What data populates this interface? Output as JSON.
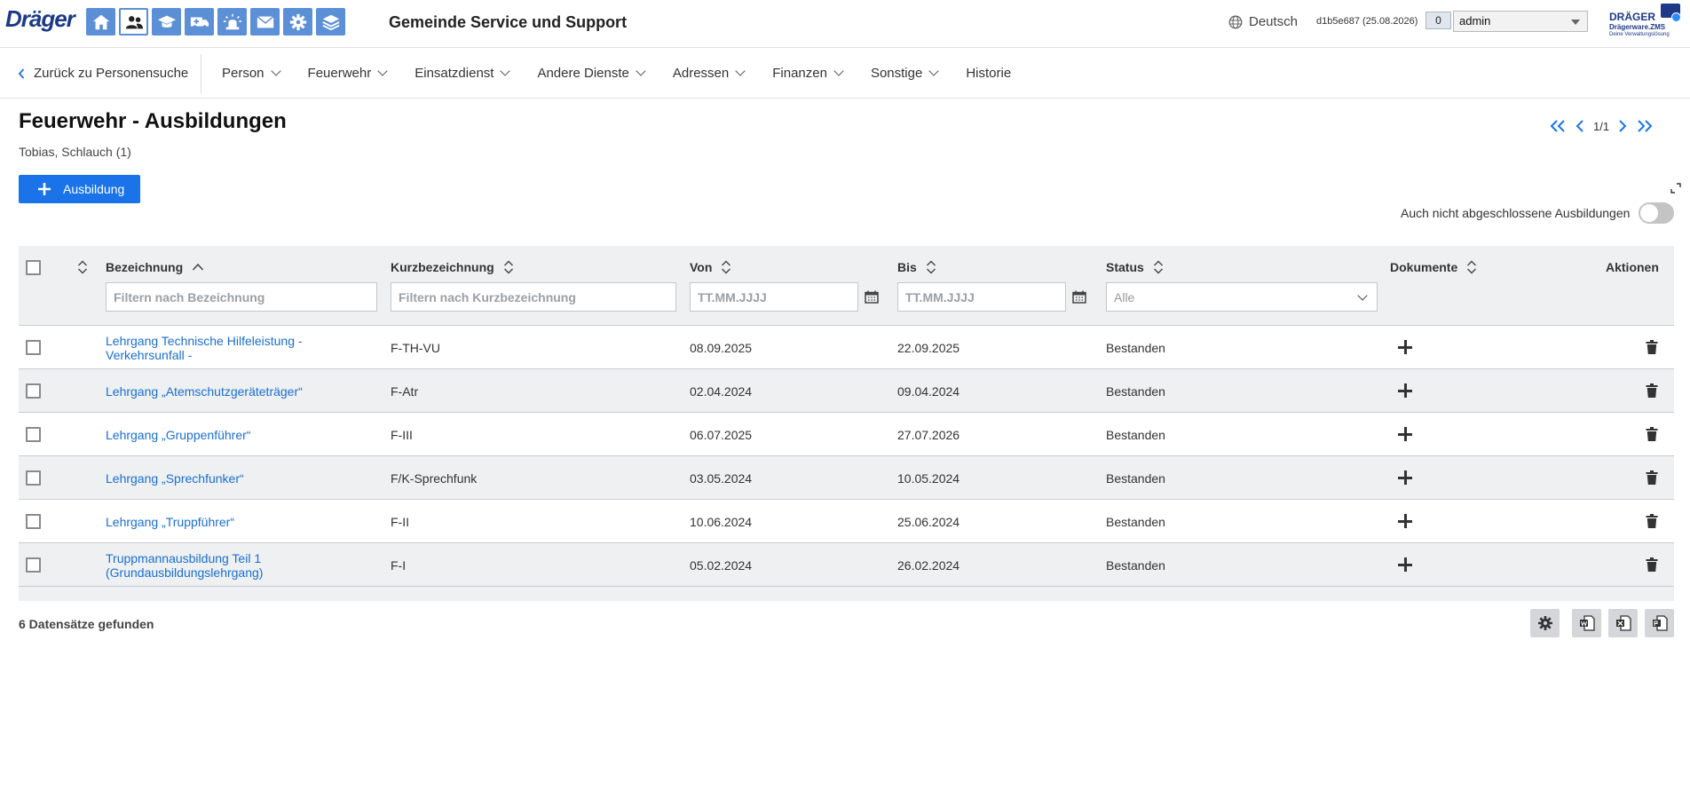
{
  "header": {
    "logo": "Dräger",
    "app_title": "Gemeinde Service und Support",
    "language": "Deutsch",
    "version": "d1b5e687 (25.08.2026)",
    "notification_count": "0",
    "user": "admin",
    "brand_name": "DRÄGER",
    "brand_product": "Drägerware.ZMS",
    "brand_tagline": "Deine Verwaltungslösung",
    "app_icons": [
      "home-icon",
      "persons-icon",
      "graduation-cap-icon",
      "ambulance-icon",
      "siren-icon",
      "mail-icon",
      "gear-icon",
      "layers-icon"
    ],
    "accent_color": "#1a73e8"
  },
  "nav": {
    "back_label": "Zurück zu Personensuche",
    "items": [
      {
        "label": "Person",
        "dropdown": true
      },
      {
        "label": "Feuerwehr",
        "dropdown": true
      },
      {
        "label": "Einsatzdienst",
        "dropdown": true
      },
      {
        "label": "Andere Dienste",
        "dropdown": true
      },
      {
        "label": "Adressen",
        "dropdown": true
      },
      {
        "label": "Finanzen",
        "dropdown": true
      },
      {
        "label": "Sonstige",
        "dropdown": true
      },
      {
        "label": "Historie",
        "dropdown": false
      }
    ]
  },
  "page": {
    "title": "Feuerwehr - Ausbildungen",
    "subtitle": "Tobias, Schlauch (1)",
    "pager": "1/1",
    "add_button": "Ausbildung",
    "toggle_label": "Auch nicht abgeschlossene Ausbildungen"
  },
  "table": {
    "columns": {
      "bezeichnung": "Bezeichnung",
      "kurz": "Kurzbezeichnung",
      "von": "Von",
      "bis": "Bis",
      "status": "Status",
      "dokumente": "Dokumente",
      "aktionen": "Aktionen"
    },
    "filters": {
      "bezeichnung": "Filtern nach Bezeichnung",
      "kurz": "Filtern nach Kurzbezeichnung",
      "von": "TT.MM.JJJJ",
      "bis": "TT.MM.JJJJ",
      "status": "Alle"
    },
    "rows": [
      {
        "bezeichnung_1": "Lehrgang Technische Hilfeleistung -",
        "bezeichnung_2": "Verkehrsunfall -",
        "kurz": "F-TH-VU",
        "von": "08.09.2025",
        "bis": "22.09.2025",
        "status": "Bestanden"
      },
      {
        "bezeichnung_1": "Lehrgang „Atemschutzgeräteträger“",
        "bezeichnung_2": "",
        "kurz": "F-Atr",
        "von": "02.04.2024",
        "bis": "09.04.2024",
        "status": "Bestanden"
      },
      {
        "bezeichnung_1": "Lehrgang „Gruppenführer“",
        "bezeichnung_2": "",
        "kurz": "F-III",
        "von": "06.07.2025",
        "bis": "27.07.2026",
        "status": "Bestanden"
      },
      {
        "bezeichnung_1": "Lehrgang „Sprechfunker“",
        "bezeichnung_2": "",
        "kurz": "F/K-Sprechfunk",
        "von": "03.05.2024",
        "bis": "10.05.2024",
        "status": "Bestanden"
      },
      {
        "bezeichnung_1": "Lehrgang „Truppführer“",
        "bezeichnung_2": "",
        "kurz": "F-II",
        "von": "10.06.2024",
        "bis": "25.06.2024",
        "status": "Bestanden"
      },
      {
        "bezeichnung_1": "Truppmannausbildung Teil 1",
        "bezeichnung_2": "(Grundausbildungslehrgang)",
        "kurz": "F-I",
        "von": "05.02.2024",
        "bis": "26.02.2024",
        "status": "Bestanden"
      }
    ]
  },
  "footer": {
    "count": "6 Datensätze gefunden"
  }
}
